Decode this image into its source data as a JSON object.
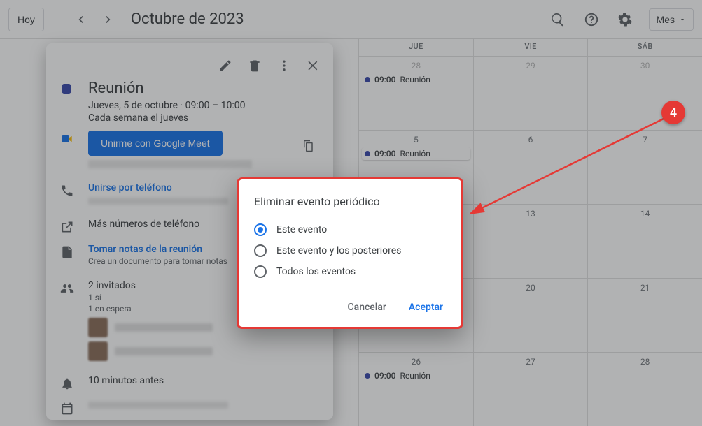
{
  "header": {
    "today": "Hoy",
    "title": "Octubre de 2023",
    "view": "Mes"
  },
  "weekdays": [
    "JUE",
    "VIE",
    "SÁB"
  ],
  "weeks": [
    {
      "days": [
        {
          "n": "28",
          "other": true,
          "ev": true
        },
        {
          "n": "29",
          "other": true
        },
        {
          "n": "30",
          "other": true
        }
      ]
    },
    {
      "days": [
        {
          "n": "5",
          "ev": true,
          "sel": true
        },
        {
          "n": "6"
        },
        {
          "n": "7"
        }
      ]
    },
    {
      "days": [
        {
          "n": ""
        },
        {
          "n": "13"
        },
        {
          "n": "14"
        }
      ]
    },
    {
      "days": [
        {
          "n": ""
        },
        {
          "n": "20"
        },
        {
          "n": "21"
        }
      ]
    },
    {
      "days": [
        {
          "n": "26",
          "ev": true
        },
        {
          "n": "27"
        },
        {
          "n": "28"
        }
      ]
    }
  ],
  "chip": {
    "time": "09:00",
    "title": "Reunión"
  },
  "event": {
    "name": "Reunión",
    "when": "Jueves, 5 de octubre  ·  09:00 – 10:00",
    "recurrence": "Cada semana el jueves",
    "meet_label": "Unirme con Google Meet",
    "phone_link": "Unirse por teléfono",
    "more_numbers": "Más números de teléfono",
    "notes_link": "Tomar notas de la reunión",
    "notes_sub": "Crea un documento para tomar notas",
    "guests_title": "2 invitados",
    "guests_yes": "1 sí",
    "guests_wait": "1 en espera",
    "reminder": "10 minutos antes"
  },
  "modal": {
    "title": "Eliminar evento periódico",
    "opt1": "Este evento",
    "opt2": "Este evento y los posteriores",
    "opt3": "Todos los eventos",
    "cancel": "Cancelar",
    "ok": "Aceptar"
  },
  "annotation": {
    "num": "4"
  }
}
